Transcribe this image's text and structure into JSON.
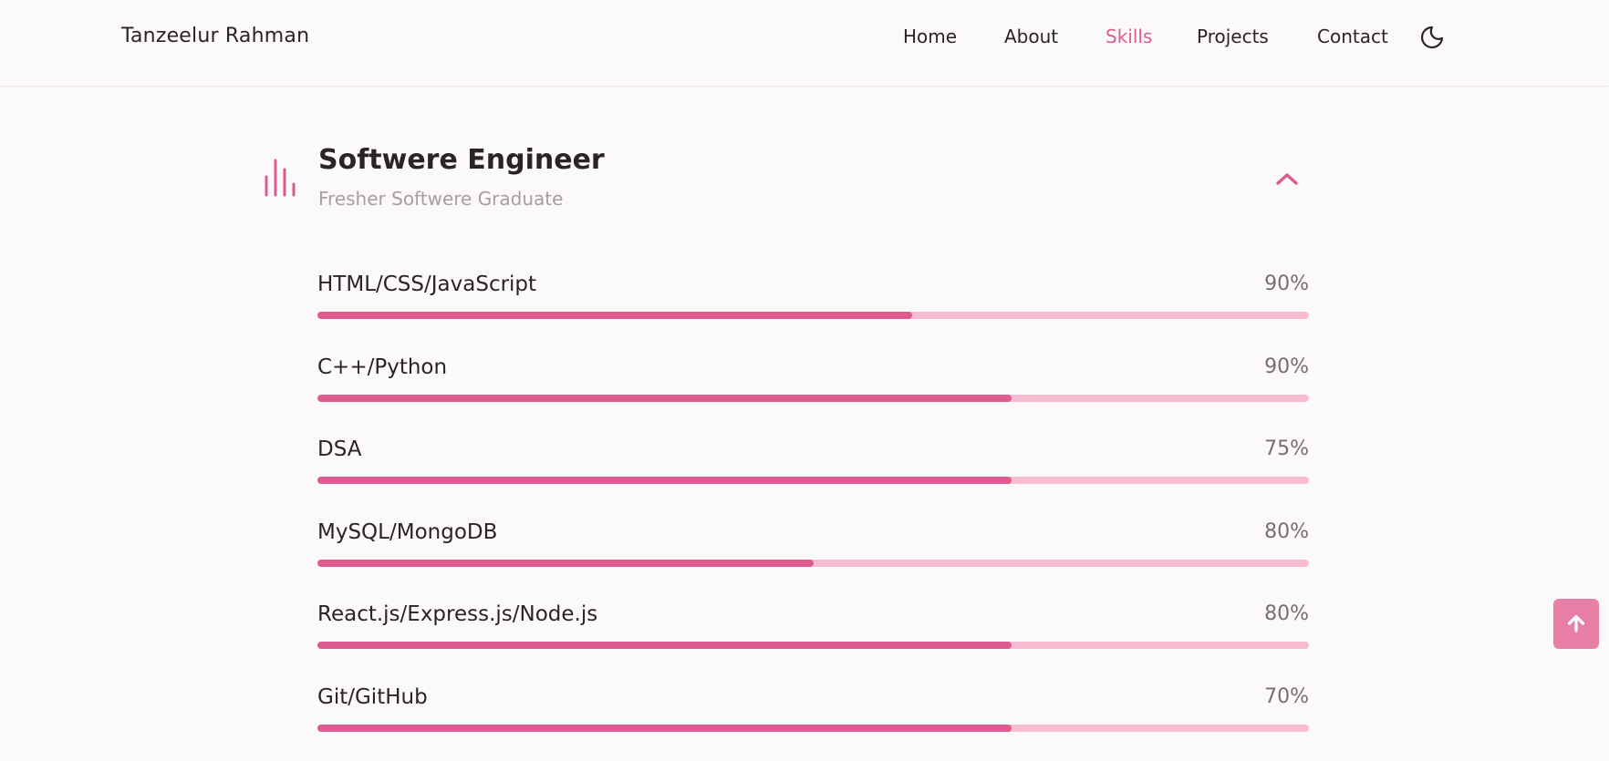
{
  "header": {
    "logo": "Tanzeelur Rahman",
    "nav": [
      {
        "label": "Home"
      },
      {
        "label": "About"
      },
      {
        "label": "Skills",
        "active": true
      },
      {
        "label": "Projects"
      },
      {
        "label": "Contact"
      }
    ],
    "theme_toggle_icon": "moon-icon"
  },
  "section": {
    "icon": "equalizer-icon",
    "title": "Softwere Engineer",
    "subtitle": "Fresher Softwere Graduate",
    "collapse_icon": "chevron-up-icon"
  },
  "skills": [
    {
      "name": "HTML/CSS/JavaScript",
      "percent_label": "90%",
      "bar_fill": 0.6
    },
    {
      "name": "C++/Python",
      "percent_label": "90%",
      "bar_fill": 0.7
    },
    {
      "name": "DSA",
      "percent_label": "75%",
      "bar_fill": 0.7
    },
    {
      "name": "MySQL/MongoDB",
      "percent_label": "80%",
      "bar_fill": 0.5
    },
    {
      "name": "React.js/Express.js/Node.js",
      "percent_label": "80%",
      "bar_fill": 0.7
    },
    {
      "name": "Git/GitHub",
      "percent_label": "70%",
      "bar_fill": 0.7
    }
  ],
  "scroll_top_icon": "arrow-up-icon",
  "colors": {
    "accent": "#dd5b8e",
    "bar_track": "#f7bcd1",
    "background": "#fcf9fb",
    "scroll_button": "#e87fa6"
  }
}
